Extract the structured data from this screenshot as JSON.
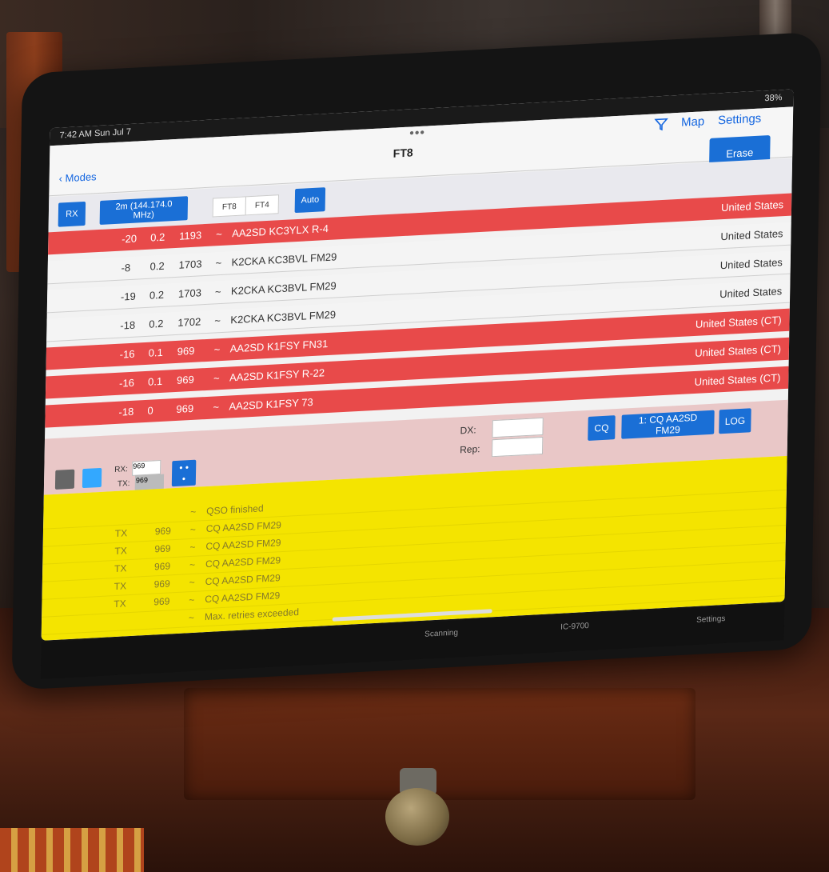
{
  "status": {
    "time": "7:42 AM  Sun Jul 7",
    "battery": "38%"
  },
  "nav": {
    "dots": "•••",
    "back_label": "Modes",
    "title": "FT8",
    "map_label": "Map",
    "settings_label": "Settings",
    "erase_label": "Erase"
  },
  "toolbar": {
    "rx_label": "RX",
    "band_label": "2m (144.174.0 MHz)",
    "mode_ft8": "FT8",
    "mode_ft4": "FT4",
    "auto_label": "Auto"
  },
  "decodes": [
    {
      "time": "",
      "db": "-20",
      "dt": "0.2",
      "freq": "1193",
      "sep": "~",
      "msg": "AA2SD KC3YLX R-4",
      "country": "United States",
      "color": "red"
    },
    {
      "time": "",
      "db": "-8",
      "dt": "0.2",
      "freq": "1703",
      "sep": "~",
      "msg": "K2CKA KC3BVL FM29",
      "country": "United States",
      "color": "white"
    },
    {
      "time": "",
      "db": "-19",
      "dt": "0.2",
      "freq": "1703",
      "sep": "~",
      "msg": "K2CKA KC3BVL FM29",
      "country": "United States",
      "color": "white"
    },
    {
      "time": "",
      "db": "-18",
      "dt": "0.2",
      "freq": "1702",
      "sep": "~",
      "msg": "K2CKA KC3BVL FM29",
      "country": "United States",
      "color": "white"
    },
    {
      "time": "",
      "db": "-16",
      "dt": "0.1",
      "freq": "969",
      "sep": "~",
      "msg": "AA2SD K1FSY FN31",
      "country": "United States (CT)",
      "color": "red"
    },
    {
      "time": "",
      "db": "-16",
      "dt": "0.1",
      "freq": "969",
      "sep": "~",
      "msg": "AA2SD K1FSY R-22",
      "country": "United States (CT)",
      "color": "red"
    },
    {
      "time": "",
      "db": "-18",
      "dt": "0",
      "freq": "969",
      "sep": "~",
      "msg": "AA2SD K1FSY 73",
      "country": "United States (CT)",
      "color": "red"
    }
  ],
  "qso": {
    "dx_label": "DX:",
    "rep_label": "Rep:",
    "dx_value": "",
    "rep_value": "",
    "cq_label": "CQ",
    "next_label": "1: CQ AA2SD FM29",
    "log_label": "LOG",
    "rx_label": "RX:",
    "rx_value": "969",
    "tx_label": "TX:",
    "tx_value": "969",
    "more_label": "• • •"
  },
  "log": [
    {
      "time": "",
      "mode": "",
      "freq": "",
      "sep": "~",
      "msg": "QSO finished"
    },
    {
      "time": "",
      "mode": "TX",
      "freq": "969",
      "sep": "~",
      "msg": "CQ AA2SD FM29"
    },
    {
      "time": "",
      "mode": "TX",
      "freq": "969",
      "sep": "~",
      "msg": "CQ AA2SD FM29"
    },
    {
      "time": "",
      "mode": "TX",
      "freq": "969",
      "sep": "~",
      "msg": "CQ AA2SD FM29"
    },
    {
      "time": "",
      "mode": "TX",
      "freq": "969",
      "sep": "~",
      "msg": "CQ AA2SD FM29"
    },
    {
      "time": "",
      "mode": "TX",
      "freq": "969",
      "sep": "~",
      "msg": "CQ AA2SD FM29"
    },
    {
      "time": "",
      "mode": "",
      "freq": "",
      "sep": "~",
      "msg": "Max. retries exceeded"
    }
  ],
  "tabs": {
    "t1": "",
    "t2": "",
    "t3": "",
    "t4": "Scanning",
    "t5": "IC-9700",
    "t6": "Settings"
  },
  "colors": {
    "red": "#e84a4a",
    "yellow": "#f4e400",
    "blue": "#1a6fd6"
  }
}
